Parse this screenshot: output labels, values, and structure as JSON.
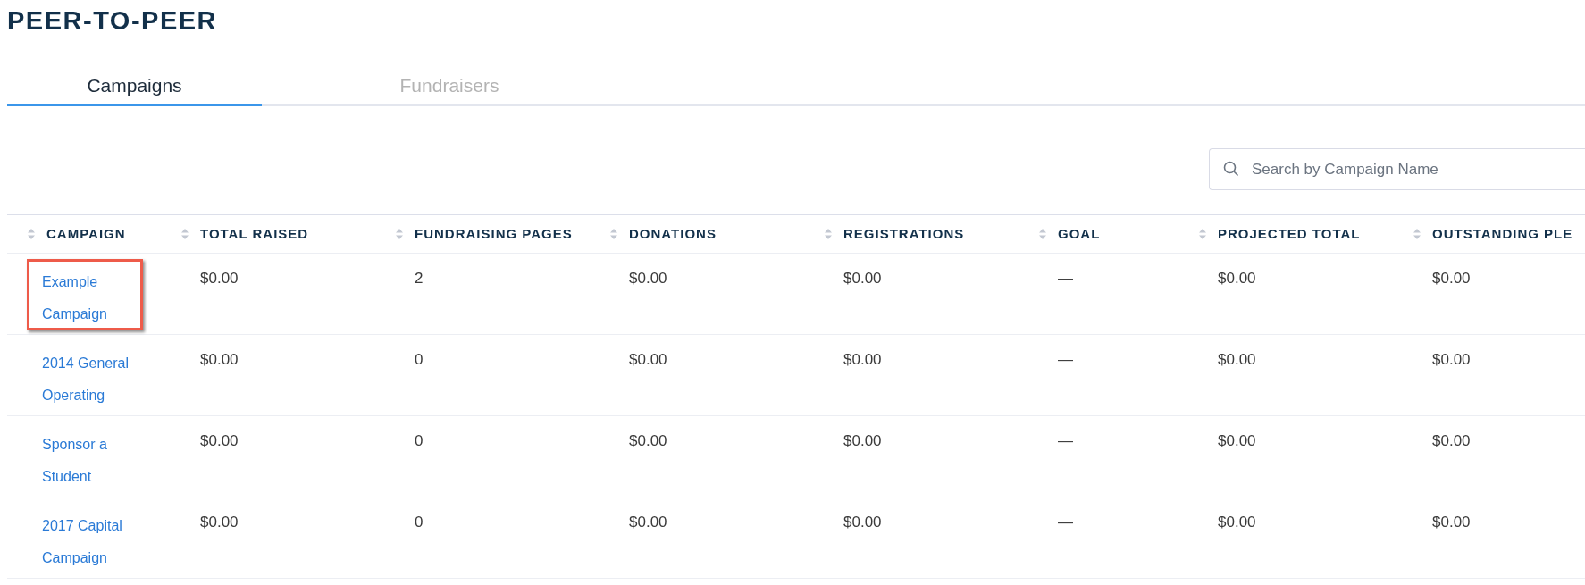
{
  "title": "PEER-TO-PEER",
  "tabs": [
    {
      "label": "Campaigns",
      "selected": true
    },
    {
      "label": "Fundraisers",
      "selected": false
    }
  ],
  "search": {
    "placeholder": "Search by Campaign Name"
  },
  "table": {
    "columns": [
      "CAMPAIGN",
      "TOTAL RAISED",
      "FUNDRAISING PAGES",
      "DONATIONS",
      "REGISTRATIONS",
      "GOAL",
      "PROJECTED TOTAL",
      "OUTSTANDING PLE"
    ],
    "rows": [
      {
        "highlighted": true,
        "cells": [
          "Example Campaign",
          "$0.00",
          "2",
          "$0.00",
          "$0.00",
          "—",
          "$0.00",
          "$0.00"
        ]
      },
      {
        "highlighted": false,
        "cells": [
          "2014 General Operating",
          "$0.00",
          "0",
          "$0.00",
          "$0.00",
          "—",
          "$0.00",
          "$0.00"
        ]
      },
      {
        "highlighted": false,
        "cells": [
          "Sponsor a Student",
          "$0.00",
          "0",
          "$0.00",
          "$0.00",
          "—",
          "$0.00",
          "$0.00"
        ]
      },
      {
        "highlighted": false,
        "cells": [
          "2017 Capital Campaign",
          "$0.00",
          "0",
          "$0.00",
          "$0.00",
          "—",
          "$0.00",
          "$0.00"
        ]
      }
    ]
  }
}
